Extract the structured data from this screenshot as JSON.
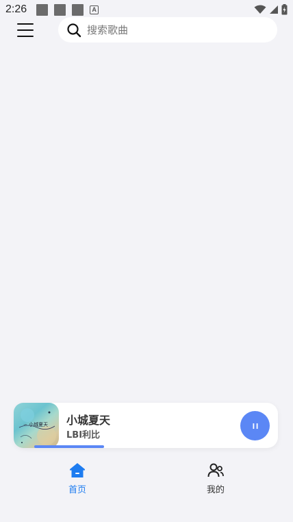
{
  "status_bar": {
    "time": "2:26"
  },
  "search": {
    "placeholder": "搜索歌曲",
    "value": ""
  },
  "player": {
    "title": "小城夏天",
    "artist": "LBI利比",
    "progress_fraction": 0.3,
    "state": "playing",
    "accent_color": "#5b87f5"
  },
  "nav": {
    "items": [
      {
        "label": "首页",
        "icon": "home-icon",
        "active": true,
        "color": "#1e7cf0"
      },
      {
        "label": "我的",
        "icon": "users-icon",
        "active": false,
        "color": "#333333"
      }
    ]
  }
}
